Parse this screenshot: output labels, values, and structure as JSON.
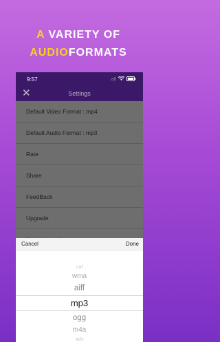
{
  "promo": {
    "line1_letter": "A",
    "line1_rest": "VARIETY OF",
    "line2_highlight": "AUDIO",
    "line2_rest": "FORMATS"
  },
  "status_bar": {
    "time": "9:57",
    "signal": "atl",
    "wifi_icon": "wifi-icon",
    "battery_icon": "battery-icon"
  },
  "nav": {
    "title": "Settings",
    "close_icon": "close-icon"
  },
  "settings_items": [
    {
      "label": "Default Video Format : mp4"
    },
    {
      "label": "Default Audio Format : mp3"
    },
    {
      "label": "Rate"
    },
    {
      "label": "Share"
    },
    {
      "label": "FeedBack"
    },
    {
      "label": "Upgrade"
    },
    {
      "label": "Help to translate"
    }
  ],
  "picker": {
    "cancel_label": "Cancel",
    "done_label": "Done",
    "options": [
      "caf",
      "wma",
      "aiff",
      "mp3",
      "ogg",
      "m4a",
      "ads"
    ],
    "selected": "mp3"
  },
  "colors": {
    "background_top": "#c46be0",
    "background_bottom": "#7a2fc4",
    "accent_yellow": "#f5d21a",
    "navbar": "#3b1868"
  }
}
